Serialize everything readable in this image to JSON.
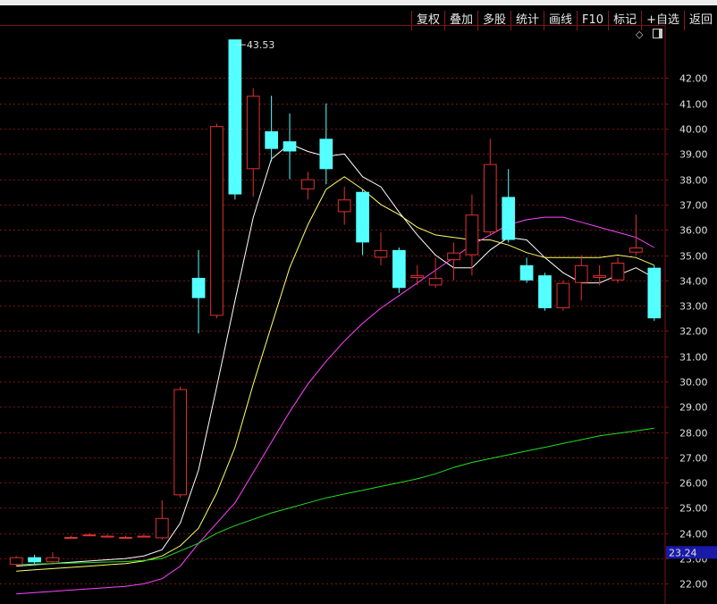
{
  "toolbar": {
    "buttons": [
      "复权",
      "叠加",
      "多股",
      "统计",
      "画线",
      "F10",
      "标记",
      "+自选",
      "返回"
    ]
  },
  "colors": {
    "background": "#000000",
    "grid": "#7a1414",
    "up_candle": "#e03030",
    "down_candle": "#54ffff",
    "ma5": "#ffffff",
    "ma10": "#ffff66",
    "ma20": "#ff44ff",
    "ma60": "#22dd22",
    "price_box": "#1a1aa8"
  },
  "icons": [
    "diamond-icon",
    "panel-toggle-icon"
  ],
  "chart_data": {
    "type": "candlestick",
    "y_axis": {
      "range": [
        21.2,
        44.1
      ],
      "ticks": [
        "22.00",
        "23.00",
        "24.00",
        "25.00",
        "26.00",
        "27.00",
        "28.00",
        "29.00",
        "30.00",
        "31.00",
        "32.00",
        "33.00",
        "34.00",
        "35.00",
        "36.00",
        "37.00",
        "38.00",
        "39.00",
        "40.00",
        "41.00",
        "42.00"
      ]
    },
    "current_price": "23.24",
    "max_label": "43.53",
    "candles": [
      {
        "o": 22.75,
        "c": 23.05,
        "h": 23.1,
        "l": 22.7
      },
      {
        "o": 23.05,
        "c": 22.85,
        "h": 23.15,
        "l": 22.8
      },
      {
        "o": 22.85,
        "c": 23.05,
        "h": 23.25,
        "l": 22.8
      },
      {
        "o": 23.85,
        "c": 23.85,
        "h": 23.9,
        "l": 23.8
      },
      {
        "o": 23.95,
        "c": 23.95,
        "h": 24.0,
        "l": 23.9
      },
      {
        "o": 23.9,
        "c": 23.9,
        "h": 23.95,
        "l": 23.85
      },
      {
        "o": 23.85,
        "c": 23.85,
        "h": 23.9,
        "l": 23.8
      },
      {
        "o": 23.9,
        "c": 23.9,
        "h": 23.95,
        "l": 23.85
      },
      {
        "o": 23.8,
        "c": 24.6,
        "h": 25.3,
        "l": 23.75
      },
      {
        "o": 25.5,
        "c": 29.7,
        "h": 29.8,
        "l": 25.4
      },
      {
        "o": 34.1,
        "c": 33.3,
        "h": 35.2,
        "l": 31.9
      },
      {
        "o": 32.6,
        "c": 40.1,
        "h": 40.2,
        "l": 32.5
      },
      {
        "o": 43.53,
        "c": 37.4,
        "h": 43.53,
        "l": 37.2
      },
      {
        "o": 38.4,
        "c": 41.3,
        "h": 41.6,
        "l": 37.3
      },
      {
        "o": 39.9,
        "c": 39.2,
        "h": 41.3,
        "l": 38.7
      },
      {
        "o": 39.5,
        "c": 39.1,
        "h": 40.6,
        "l": 38.0
      },
      {
        "o": 37.6,
        "c": 38.0,
        "h": 38.3,
        "l": 37.2
      },
      {
        "o": 39.6,
        "c": 38.4,
        "h": 41.0,
        "l": 37.8
      },
      {
        "o": 36.7,
        "c": 37.2,
        "h": 37.7,
        "l": 36.2
      },
      {
        "o": 37.5,
        "c": 35.5,
        "h": 37.6,
        "l": 35.0
      },
      {
        "o": 34.9,
        "c": 35.2,
        "h": 35.9,
        "l": 34.6
      },
      {
        "o": 35.2,
        "c": 33.7,
        "h": 35.3,
        "l": 33.5
      },
      {
        "o": 34.1,
        "c": 34.2,
        "h": 34.6,
        "l": 33.8
      },
      {
        "o": 33.8,
        "c": 34.1,
        "h": 34.9,
        "l": 33.7
      },
      {
        "o": 34.8,
        "c": 35.1,
        "h": 35.5,
        "l": 34.0
      },
      {
        "o": 35.0,
        "c": 36.6,
        "h": 37.4,
        "l": 34.2
      },
      {
        "o": 35.9,
        "c": 38.6,
        "h": 39.6,
        "l": 35.8
      },
      {
        "o": 37.3,
        "c": 35.6,
        "h": 38.4,
        "l": 35.5
      },
      {
        "o": 34.6,
        "c": 34.0,
        "h": 34.9,
        "l": 33.9
      },
      {
        "o": 34.2,
        "c": 32.9,
        "h": 34.3,
        "l": 32.8
      },
      {
        "o": 32.9,
        "c": 33.9,
        "h": 34.0,
        "l": 32.8
      },
      {
        "o": 33.9,
        "c": 34.6,
        "h": 35.0,
        "l": 33.2
      },
      {
        "o": 34.1,
        "c": 34.2,
        "h": 34.6,
        "l": 33.8
      },
      {
        "o": 34.0,
        "c": 34.7,
        "h": 34.9,
        "l": 33.9
      },
      {
        "o": 35.1,
        "c": 35.3,
        "h": 36.6,
        "l": 35.0
      },
      {
        "o": 34.5,
        "c": 32.5,
        "h": 34.6,
        "l": 32.4
      }
    ],
    "series": [
      {
        "key": "ma5",
        "values": [
          22.7,
          22.75,
          22.8,
          22.85,
          22.9,
          22.95,
          23.0,
          23.1,
          23.35,
          24.4,
          26.5,
          29.8,
          33.2,
          36.5,
          38.8,
          39.4,
          39.1,
          38.9,
          39.0,
          38.1,
          37.7,
          36.7,
          35.8,
          35.0,
          34.5,
          34.5,
          35.2,
          35.7,
          35.6,
          34.9,
          34.3,
          33.9,
          33.9,
          34.2,
          34.5,
          34.1
        ]
      },
      {
        "key": "ma10",
        "values": [
          22.5,
          22.55,
          22.6,
          22.65,
          22.7,
          22.75,
          22.8,
          22.9,
          23.1,
          23.5,
          24.2,
          25.6,
          27.4,
          29.9,
          32.2,
          34.5,
          36.2,
          37.6,
          38.1,
          37.6,
          37.0,
          36.6,
          36.1,
          35.8,
          35.7,
          35.6,
          35.6,
          35.4,
          35.1,
          34.9,
          34.9,
          34.9,
          34.9,
          35.0,
          34.9,
          34.6
        ]
      },
      {
        "key": "ma20",
        "values": [
          21.6,
          21.65,
          21.7,
          21.75,
          21.8,
          21.85,
          21.9,
          22.0,
          22.2,
          22.7,
          23.6,
          24.4,
          25.2,
          26.4,
          27.6,
          28.8,
          29.9,
          30.8,
          31.6,
          32.3,
          32.9,
          33.4,
          33.9,
          34.4,
          34.9,
          35.4,
          35.8,
          36.2,
          36.4,
          36.5,
          36.5,
          36.3,
          36.1,
          35.9,
          35.7,
          35.3
        ]
      },
      {
        "key": "ma60",
        "values": [
          22.75,
          22.78,
          22.8,
          22.82,
          22.84,
          22.86,
          22.88,
          22.92,
          23.0,
          23.3,
          23.6,
          24.0,
          24.3,
          24.55,
          24.8,
          25.0,
          25.2,
          25.4,
          25.55,
          25.7,
          25.85,
          26.0,
          26.15,
          26.35,
          26.6,
          26.8,
          26.95,
          27.1,
          27.25,
          27.4,
          27.55,
          27.7,
          27.85,
          27.95,
          28.05,
          28.15
        ]
      }
    ]
  }
}
